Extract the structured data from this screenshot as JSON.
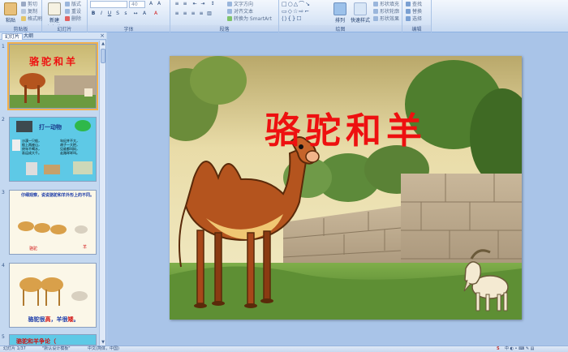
{
  "ribbon": {
    "clipboard": {
      "paste_label": "粘贴",
      "cut_label": "剪切",
      "copy_label": "复制",
      "format_painter_label": "格式刷",
      "group_label": "剪贴板"
    },
    "slides": {
      "new_slide_label": "新建\n幻灯片",
      "layout_label": "版式",
      "reset_label": "重设",
      "delete_label": "删除",
      "group_label": "幻灯片"
    },
    "font": {
      "font_name": "",
      "font_size": "40",
      "bold": "B",
      "italic": "I",
      "underline": "U",
      "group_label": "字体"
    },
    "paragraph": {
      "text_direction_label": "文字方向",
      "align_text_label": "对齐文本",
      "smartart_label": "转换为 SmartArt",
      "group_label": "段落"
    },
    "drawing": {
      "arrange_label": "排列",
      "quick_styles_label": "快速样式",
      "shape_fill_label": "形状填充",
      "shape_outline_label": "形状轮廓",
      "shape_effects_label": "形状效果",
      "group_label": "绘图"
    },
    "editing": {
      "find_label": "查找",
      "replace_label": "替换",
      "select_label": "选择",
      "group_label": "编辑"
    }
  },
  "panel": {
    "tabs": [
      "幻灯片",
      "大纲"
    ],
    "close_glyph": "×",
    "slides": [
      {
        "number": "1",
        "title": "骆驼和羊"
      },
      {
        "number": "2",
        "title": "打一动物",
        "left_text": "沙漠一只船，\n船上两座山，\n终年不喝水，\n驮运成大千。",
        "right_text": "年纪并不大，\n胡子一大把，\n见谁都叫妈，\n走路咩咩叫。"
      },
      {
        "number": "3",
        "text": "仔细观察，说说骆驼和羊外形上的不同。",
        "label_camel": "骆驼",
        "label_sheep": "羊"
      },
      {
        "number": "4",
        "caption_a": "骆驼很",
        "caption_b": "高",
        "caption_c": "，羊很",
        "caption_d": "矮",
        "caption_e": "。"
      },
      {
        "number": "5",
        "text": "骆驼和羊争论（"
      }
    ]
  },
  "slide": {
    "title": "骆驼和羊"
  },
  "status": {
    "slide_info": "幻灯片 1/37",
    "theme": "\"默认设计模板\"",
    "language": "中文(简体，中国)"
  },
  "colors": {
    "title_red": "#ee1010",
    "ribbon_blue": "#dbe7f7",
    "selection": "#f3b04a"
  }
}
